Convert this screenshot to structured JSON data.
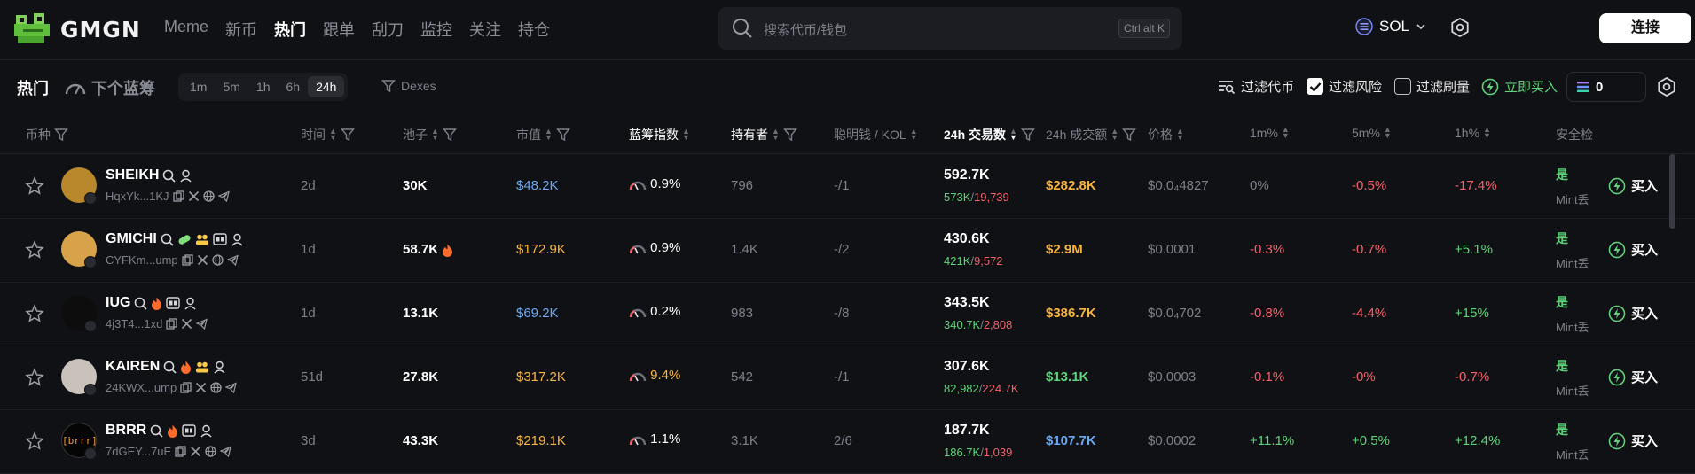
{
  "brand": {
    "name": "GMGN"
  },
  "nav": [
    {
      "label": "Meme"
    },
    {
      "label": "新币"
    },
    {
      "label": "热门",
      "active": true
    },
    {
      "label": "跟单"
    },
    {
      "label": "刮刀"
    },
    {
      "label": "监控"
    },
    {
      "label": "关注"
    },
    {
      "label": "持仓"
    }
  ],
  "search": {
    "placeholder": "搜索代币/钱包",
    "shortcut": "Ctrl alt K"
  },
  "chain": {
    "label": "SOL"
  },
  "connect_label": "连接",
  "filterbar": {
    "title": "热门",
    "next_blue": "下个蓝筹",
    "timeframes": [
      {
        "label": "1m"
      },
      {
        "label": "5m"
      },
      {
        "label": "1h"
      },
      {
        "label": "6h"
      },
      {
        "label": "24h",
        "active": true
      }
    ],
    "dexes": "Dexes",
    "filter_token": "过滤代币",
    "filter_risk": "过滤风险",
    "filter_risk_checked": true,
    "filter_wash": "过滤刷量",
    "filter_wash_checked": false,
    "buy_now": "立即买入",
    "quick_amount": "0"
  },
  "columns": {
    "token": "币种",
    "time": "时间",
    "pool": "池子",
    "mcap": "市值",
    "bluechip": "蓝筹指数",
    "holders": "持有者",
    "smart_kol": "聪明钱 / KOL",
    "txs": "24h 交易数",
    "volume": "24h 成交额",
    "price": "价格",
    "m1": "1m%",
    "m5": "5m%",
    "h1": "1h%",
    "safety": "安全检"
  },
  "rows": [
    {
      "name": "SHEIKH",
      "addr": "HqxYk...1KJ",
      "time": "2d",
      "pool": "30K",
      "pool_hot": false,
      "mcap": "$48.2K",
      "mcap_color": "#6ba8f0",
      "bluechip": "0.9%",
      "bluechip_color": "#ffffff",
      "holders": "796",
      "smart_kol": "-/1",
      "txs": "592.7K",
      "buys": "573K",
      "sells": "19,739",
      "volume": "$282.8K",
      "volume_color": "#f7b440",
      "price": "$0.0₄4827",
      "m1": "0%",
      "m1_color": "#7d808a",
      "m5": "-0.5%",
      "m5_color": "#f3616b",
      "h1": "-17.4%",
      "h1_color": "#f3616b",
      "safe": "是",
      "mint": "Mint丢",
      "buy": "买入",
      "avatar_color": "#b9872c"
    },
    {
      "name": "GMICHI",
      "addr": "CYFKm...ump",
      "time": "1d",
      "pool": "58.7K",
      "pool_hot": true,
      "mcap": "$172.9K",
      "mcap_color": "#f7b440",
      "bluechip": "0.9%",
      "bluechip_color": "#ffffff",
      "holders": "1.4K",
      "smart_kol": "-/2",
      "txs": "430.6K",
      "buys": "421K",
      "sells": "9,572",
      "volume": "$2.9M",
      "volume_color": "#f7b440",
      "price": "$0.0001",
      "m1": "-0.3%",
      "m1_color": "#f3616b",
      "m5": "-0.7%",
      "m5_color": "#f3616b",
      "h1": "+5.1%",
      "h1_color": "#5fd37b",
      "safe": "是",
      "mint": "Mint丢",
      "buy": "买入",
      "avatar_color": "#d7a24a"
    },
    {
      "name": "IUG",
      "addr": "4j3T4...1xd",
      "time": "1d",
      "pool": "13.1K",
      "pool_hot": false,
      "mcap": "$69.2K",
      "mcap_color": "#6ba8f0",
      "bluechip": "0.2%",
      "bluechip_color": "#ffffff",
      "holders": "983",
      "smart_kol": "-/8",
      "txs": "343.5K",
      "buys": "340.7K",
      "sells": "2,808",
      "volume": "$386.7K",
      "volume_color": "#f7b440",
      "price": "$0.0₄702",
      "m1": "-0.8%",
      "m1_color": "#f3616b",
      "m5": "-4.4%",
      "m5_color": "#f3616b",
      "h1": "+15%",
      "h1_color": "#5fd37b",
      "safe": "是",
      "mint": "Mint丢",
      "buy": "买入",
      "avatar_color": "#0d0d0d"
    },
    {
      "name": "KAIREN",
      "addr": "24KWX...ump",
      "time": "51d",
      "pool": "27.8K",
      "pool_hot": false,
      "mcap": "$317.2K",
      "mcap_color": "#f7b440",
      "bluechip": "9.4%",
      "bluechip_color": "#f7b440",
      "holders": "542",
      "smart_kol": "-/1",
      "txs": "307.6K",
      "buys": "82,982",
      "sells": "224.7K",
      "volume": "$13.1K",
      "volume_color": "#5fd37b",
      "price": "$0.0003",
      "m1": "-0.1%",
      "m1_color": "#f3616b",
      "m5": "-0%",
      "m5_color": "#f3616b",
      "h1": "-0.7%",
      "h1_color": "#f3616b",
      "safe": "是",
      "mint": "Mint丢",
      "buy": "买入",
      "avatar_color": "#c9c2bb"
    },
    {
      "name": "BRRR",
      "addr": "7dGEY...7uE",
      "time": "3d",
      "pool": "43.3K",
      "pool_hot": false,
      "mcap": "$219.1K",
      "mcap_color": "#f7b440",
      "bluechip": "1.1%",
      "bluechip_color": "#ffffff",
      "holders": "3.1K",
      "smart_kol": "2/6",
      "txs": "187.7K",
      "buys": "186.7K",
      "sells": "1,039",
      "volume": "$107.7K",
      "volume_color": "#6ba8f0",
      "price": "$0.0002",
      "m1": "+11.1%",
      "m1_color": "#5fd37b",
      "m5": "+0.5%",
      "m5_color": "#5fd37b",
      "h1": "+12.4%",
      "h1_color": "#5fd37b",
      "safe": "是",
      "mint": "Mint丢",
      "buy": "买入",
      "avatar_color": "#050505",
      "avatar_text": "[brrr]"
    }
  ]
}
